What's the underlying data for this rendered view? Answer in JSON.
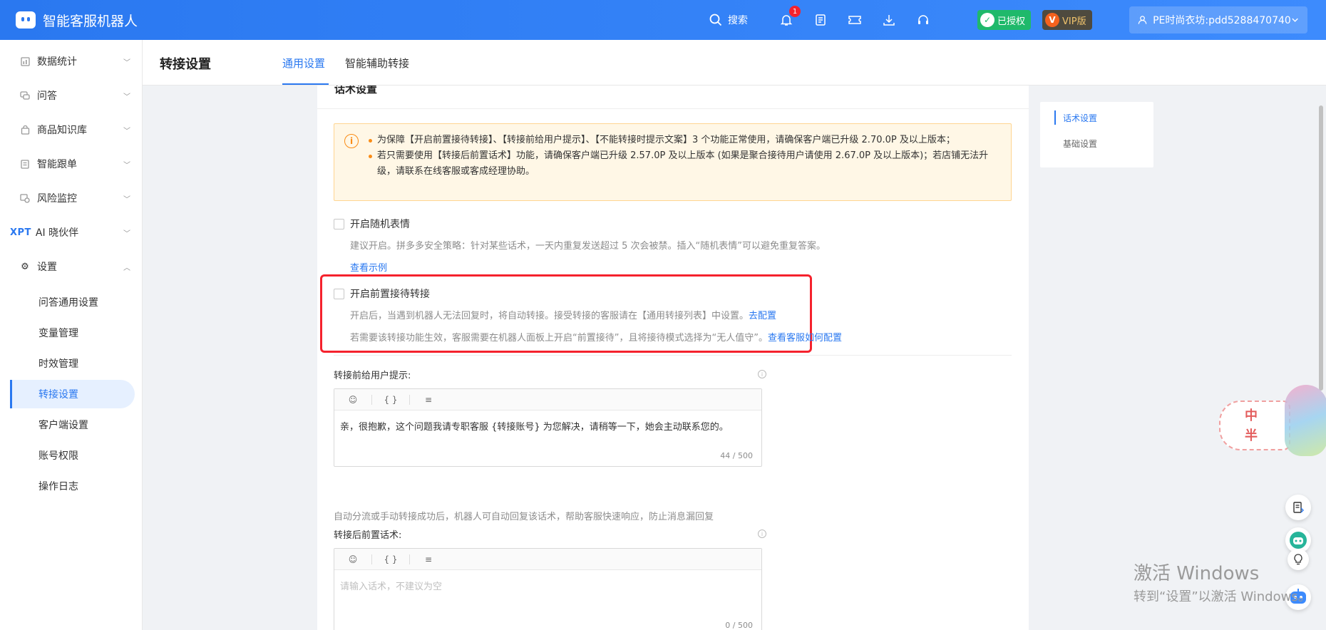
{
  "app": {
    "title": "智能客服机器人",
    "search_label": "搜索",
    "notification_count": "1",
    "auth_label": "已授权",
    "vip_label": "VIP版",
    "account_name": "PE时尚衣坊:pdd5288470740"
  },
  "sidebar": {
    "items": [
      {
        "label": "数据统计"
      },
      {
        "label": "问答"
      },
      {
        "label": "商品知识库"
      },
      {
        "label": "智能跟单"
      },
      {
        "label": "风险监控"
      },
      {
        "label": "AI 晓伙伴",
        "prefix": "XPT"
      },
      {
        "label": "设置"
      }
    ],
    "sub_items": [
      {
        "label": "问答通用设置"
      },
      {
        "label": "变量管理"
      },
      {
        "label": "时效管理"
      },
      {
        "label": "转接设置"
      },
      {
        "label": "客户端设置"
      },
      {
        "label": "账号权限"
      },
      {
        "label": "操作日志"
      }
    ]
  },
  "header": {
    "page_title": "转接设置",
    "tabs": [
      {
        "label": "通用设置"
      },
      {
        "label": "智能辅助转接"
      }
    ]
  },
  "panel": {
    "section_title": "话术设置",
    "alert_lines": [
      "为保障【开启前置接待转接】、【转接前给用户提示】、【不能转接时提示文案】3 个功能正常使用，请确保客户端已升级 2.70.0P 及以上版本；",
      "若只需要使用【转接后前置话术】功能，请确保客户端已升级 2.57.0P 及以上版本 (如果是聚合接待用户请使用 2.67.0P 及以上版本)；若店铺无法升级，请联系在线客服或客成经理协助。"
    ],
    "random_emoji": {
      "label": "开启随机表情",
      "desc": "建议开启。拼多多安全策略：针对某些话术，一天内重复发送超过 5 次会被禁。插入“随机表情”可以避免重复答案。",
      "link": "查看示例"
    },
    "pre_reception": {
      "label": "开启前置接待转接",
      "desc1": "开启后，当遇到机器人无法回复时，将自动转接。接受转接的客服请在【通用转接列表】中设置。",
      "desc1_link": "去配置",
      "desc2": "若需要该转接功能生效，客服需要在机器人面板上开启“前置接待”，且将接待模式选择为“无人值守”。",
      "desc2_link": "查看客服如何配置"
    },
    "before_transfer": {
      "label": "转接前给用户提示:",
      "content": "亲，很抱歉，这个问题我请专职客服 {转接账号} 为您解决，请稍等一下，她会主动联系您的。",
      "counter": "44 / 500"
    },
    "after_desc": "自动分流或手动转接成功后，机器人可自动回复该话术，帮助客服快速响应，防止消息漏回复",
    "after_transfer": {
      "label": "转接后前置话术:",
      "placeholder": "请输入话术，不建议为空",
      "counter": "0 / 500"
    },
    "toolbar": {
      "emoji": "☺",
      "variable": "{ }",
      "separator": "≡"
    }
  },
  "anchor_nav": {
    "items": [
      {
        "label": "话术设置"
      },
      {
        "label": "基础设置"
      }
    ]
  },
  "sticker": {
    "line1": "中",
    "line2": "半"
  },
  "watermark": {
    "line1": "激活 Windows",
    "line2": "转到“设置”以激活 Windows。"
  },
  "colors": {
    "primary": "#2a78f0",
    "alert_bg": "#fff7e6",
    "highlight": "#f5222d"
  }
}
